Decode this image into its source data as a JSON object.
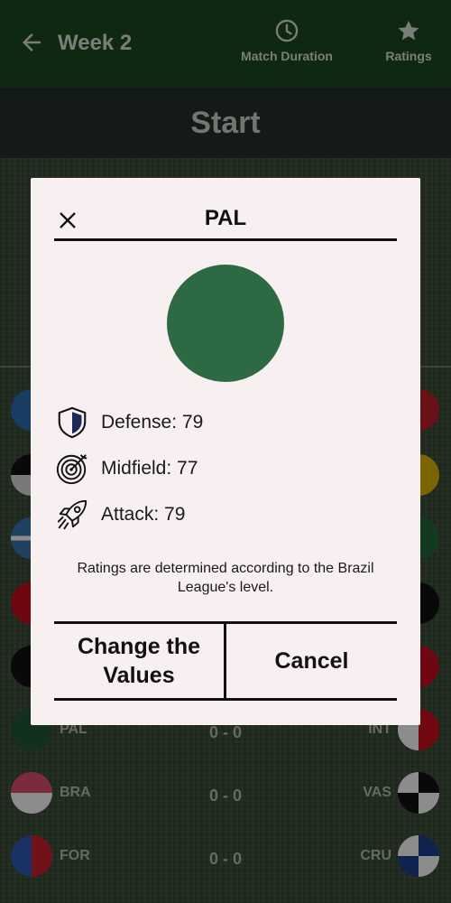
{
  "topbar": {
    "title": "Week 2",
    "match_duration_label": "Match Duration",
    "ratings_label": "Ratings"
  },
  "start_label": "Start",
  "matches": [
    {
      "home": "PAL",
      "score": "0 - 0",
      "away": "INT"
    },
    {
      "home": "BRA",
      "score": "0 - 0",
      "away": "VAS"
    },
    {
      "home": "FOR",
      "score": "0 - 0",
      "away": "CRU"
    }
  ],
  "dialog": {
    "title": "PAL",
    "team_color": "#2d6a43",
    "stats": {
      "defense": "Defense: 79",
      "midfield": "Midfield: 77",
      "attack": "Attack: 79"
    },
    "note": "Ratings are determined according to the Brazil League's level.",
    "change_button": "Change the Values",
    "cancel_button": "Cancel"
  },
  "icons": {
    "back": "arrow-left-icon",
    "duration": "clock-icon",
    "ratings": "star-icon",
    "close": "close-icon",
    "defense": "shield-icon",
    "midfield": "target-icon",
    "attack": "rocket-icon"
  }
}
